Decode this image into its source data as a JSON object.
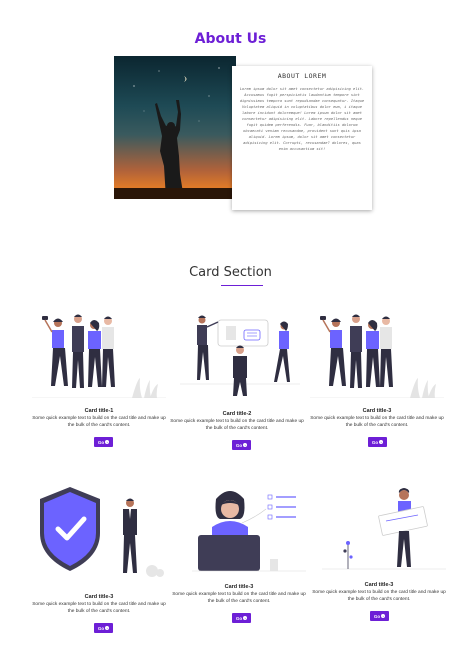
{
  "about": {
    "title": "About Us",
    "card_title": "ABOUT LOREM",
    "card_text": "Lorem ipsum dolor sit amet consectetur adipisicing elit. Accusamus fugit perspiciatis laudantium tempore sint dignissimos tempora sunt repudiandae consequatur. Itaque Voluptatem aliquid in voluptatibus dolor eum, i itaque labore incidunt doloremque! Lorem ipsum dolor sit amet consectetur adipisicing elit. Labore repellendus neque fugit quidem perferendis. Fuar, blanditiis dolorum obcaecati veniam recusandae, provident sunt quis ipsa aliquid. Lorem ipsum, dolor sit amet consectetur adipisicing elit. Corrupti, recusandae? dolores, quas enim accusantium sit!"
  },
  "cards_section": {
    "title": "Card Section",
    "accent_color": "#6d1fd6",
    "cards": [
      {
        "title": "Card title-1",
        "text": "Some quick example text to build on the card title and make up the bulk of the card's content.",
        "button": "Go",
        "illustration": "team-selfie-illustration"
      },
      {
        "title": "Card title-2",
        "text": "Some quick example text to build on the card title and make up the bulk of the card's content.",
        "button": "Go",
        "illustration": "presentation-illustration"
      },
      {
        "title": "Card title-3",
        "text": "Some quick example text to build on the card title and make up the bulk of the card's content.",
        "button": "Go",
        "illustration": "team-selfie-illustration"
      },
      {
        "title": "Card title-3",
        "text": "Some quick example text to build on the card title and make up the bulk of the card's content.",
        "button": "Go",
        "illustration": "security-shield-illustration"
      },
      {
        "title": "Card title-3",
        "text": "Some quick example text to build on the card title and make up the bulk of the card's content.",
        "button": "Go",
        "illustration": "laptop-worker-illustration"
      },
      {
        "title": "Card title-3",
        "text": "Some quick example text to build on the card title and make up the bulk of the card's content.",
        "button": "Go",
        "illustration": "board-holder-illustration"
      }
    ]
  }
}
